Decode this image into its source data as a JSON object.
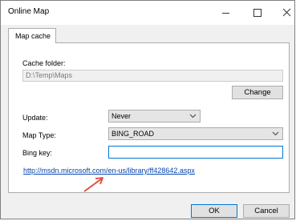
{
  "window": {
    "title": "Online Map"
  },
  "tabs": [
    {
      "label": "Map cache"
    }
  ],
  "cache": {
    "label": "Cache folder:",
    "value": "D:\\Temp\\Maps",
    "change_label": "Change"
  },
  "update": {
    "label": "Update:",
    "value": "Never"
  },
  "map_type": {
    "label": "Map Type:",
    "value": "BING_ROAD"
  },
  "bing_key": {
    "label": "Bing key:",
    "value": ""
  },
  "link": {
    "text": "http://msdn.microsoft.com/en-us/library/ff428642.aspx"
  },
  "buttons": {
    "ok_label": "OK",
    "cancel_label": "Cancel"
  },
  "colors": {
    "accent": "#0078d7",
    "annotation_arrow": "#e2483f",
    "link": "#0645ad"
  }
}
